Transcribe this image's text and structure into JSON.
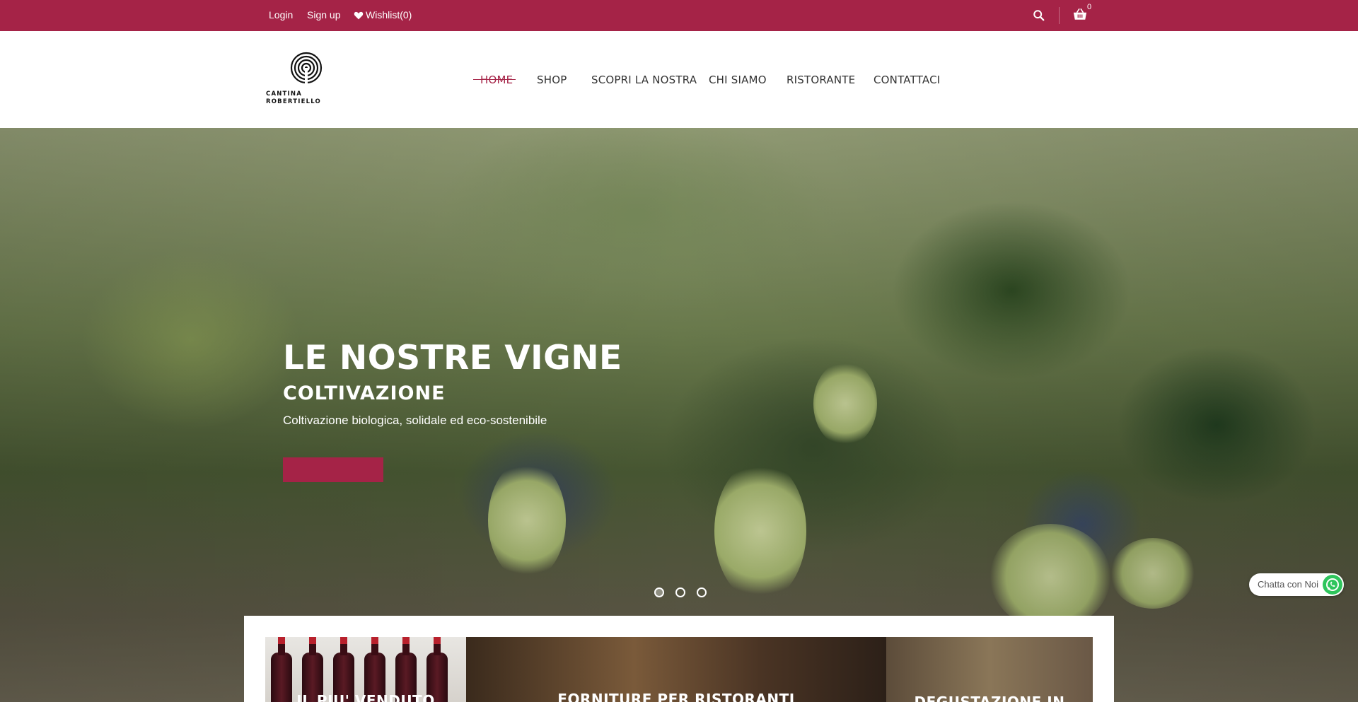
{
  "topbar": {
    "login": "Login",
    "signup": "Sign up",
    "wishlist": "Wishlist(0)",
    "cart_count": "0",
    "bg_color": "#a52347"
  },
  "header": {
    "logo_line1": "CANTINA",
    "logo_line2": "ROBERTIELLO",
    "nav": [
      {
        "label": "HOME",
        "active": true
      },
      {
        "label": "SHOP"
      },
      {
        "label": "SCOPRI LA NOSTRA"
      },
      {
        "label": "CHI SIAMO"
      },
      {
        "label": "RISTORANTE"
      },
      {
        "label": "CONTATTACI"
      }
    ]
  },
  "hero": {
    "title": "LE NOSTRE VIGNE",
    "subtitle": "COLTIVAZIONE",
    "text": "Coltivazione biologica, solidale ed eco-sostenibile",
    "slide_count": 3,
    "active_slide": 1
  },
  "chat": {
    "label": "Chatta con Noi",
    "icon": "whatsapp-icon"
  },
  "tiles": [
    {
      "title": "IL PIU' VENDUTO"
    },
    {
      "title": "FORNITURE PER RISTORANTI"
    },
    {
      "title": "DEGUSTAZIONE IN CANTINA"
    }
  ],
  "colors": {
    "accent": "#a52347",
    "nav_text": "#333333"
  }
}
